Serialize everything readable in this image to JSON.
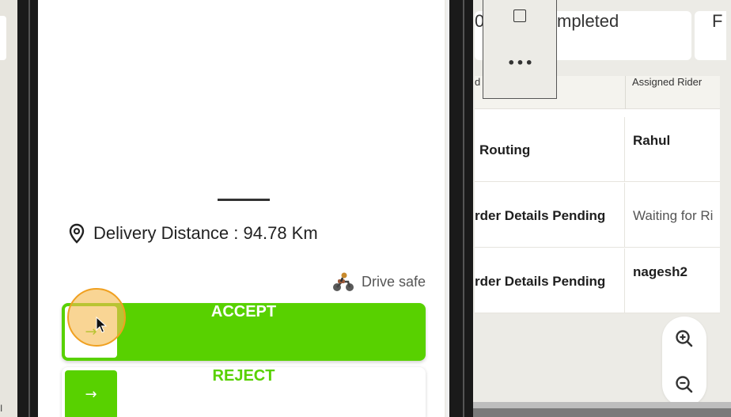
{
  "left_background": {
    "tiny_text": "I"
  },
  "phone": {
    "delivery_distance": "Delivery Distance : 94.78 Km",
    "drive_safe": "Drive safe",
    "accept_label": "ACCEPT",
    "reject_label": "REJECT",
    "arrow_glyph": "→"
  },
  "orders": {
    "tabs": {
      "prev_fragment": "0",
      "completed_fragment": "mpleted",
      "next_fragment": "F"
    },
    "popup": {
      "dots": "•••"
    },
    "columns": [
      {
        "label": "d"
      },
      {
        "label": "Assigned Rider"
      }
    ],
    "rows": [
      {
        "status": "Routing",
        "rider": "Rahul"
      },
      {
        "status": "rder Details Pending",
        "rider": "Waiting for Ri"
      },
      {
        "status": "rder Details Pending",
        "rider": "nagesh2"
      }
    ]
  },
  "colors": {
    "accent_green": "#58d100",
    "click_ring": "#f6bc52"
  },
  "icons": [
    "location-pin-icon",
    "rider-icon",
    "arrow-right-icon",
    "zoom-in-icon",
    "zoom-out-icon",
    "checkbox-square-icon",
    "more-dots-icon",
    "cursor-icon"
  ]
}
